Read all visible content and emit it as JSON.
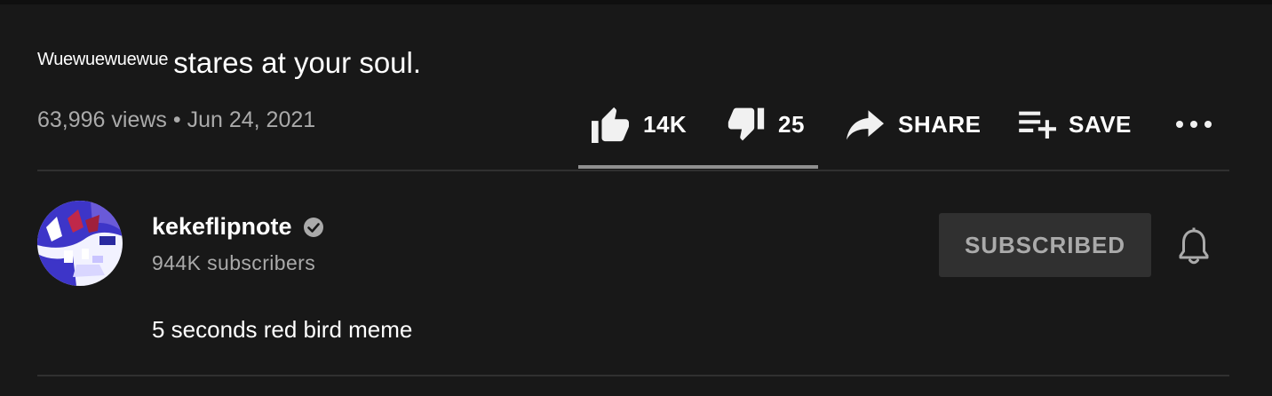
{
  "video": {
    "title_prefix": "Wuewuewuewue",
    "title_main": "stares at your soul.",
    "views": "63,996 views",
    "separator": "•",
    "date": "Jun 24, 2021"
  },
  "actions": {
    "like_count": "14K",
    "dislike_count": "25",
    "share_label": "SHARE",
    "save_label": "SAVE",
    "like_ratio": 0.998
  },
  "channel": {
    "name": "kekeflipnote",
    "subscribers": "944K subscribers",
    "verified": true,
    "subscribe_label": "SUBSCRIBED"
  },
  "description": {
    "text": "5 seconds red bird meme"
  },
  "icons": {
    "like": "thumb-up-icon",
    "dislike": "thumb-down-icon",
    "share": "share-arrow-icon",
    "save": "playlist-add-icon",
    "more": "more-horizontal-icon",
    "verified": "verified-check-icon",
    "notifications": "bell-icon"
  },
  "colors": {
    "background": "#181818",
    "secondary_text": "#aaaaaa",
    "divider": "#303030",
    "subscribed_button_bg": "#303030",
    "rating_bar": "#909090"
  }
}
